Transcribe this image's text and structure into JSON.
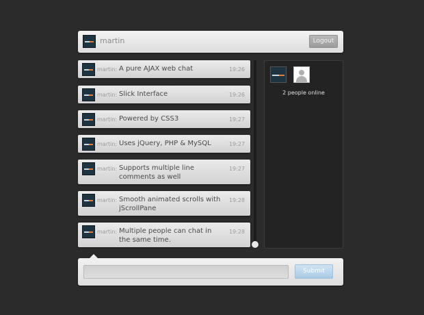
{
  "header": {
    "username": "martin",
    "logout_label": "Logout",
    "avatar_icon": "tutorialzine-logo-icon"
  },
  "messages": [
    {
      "author": "martin:",
      "text": "A pure AJAX web chat",
      "time": "19:26"
    },
    {
      "author": "martin:",
      "text": "Slick Interface",
      "time": "19:26"
    },
    {
      "author": "martin:",
      "text": "Powered by CSS3",
      "time": "19:27"
    },
    {
      "author": "martin:",
      "text": "Uses jQuery, PHP & MySQL",
      "time": "19:27"
    },
    {
      "author": "martin:",
      "text": "Supports multiple line comments as well",
      "time": "19:27"
    },
    {
      "author": "martin:",
      "text": "Smooth animated scrolls with jScrollPane",
      "time": "19:28"
    },
    {
      "author": "martin:",
      "text": "Multiple people can chat in the same time.",
      "time": "19:28"
    }
  ],
  "online": {
    "count_label": "2 people online",
    "avatars": [
      "tutorialzine-logo-icon",
      "default-user-icon"
    ]
  },
  "composer": {
    "input_value": "",
    "input_placeholder": "",
    "submit_label": "Submit"
  },
  "colors": {
    "background": "#2b2b2b",
    "submit_accent": "#a9cbe6",
    "panel_dark": "#232323"
  }
}
